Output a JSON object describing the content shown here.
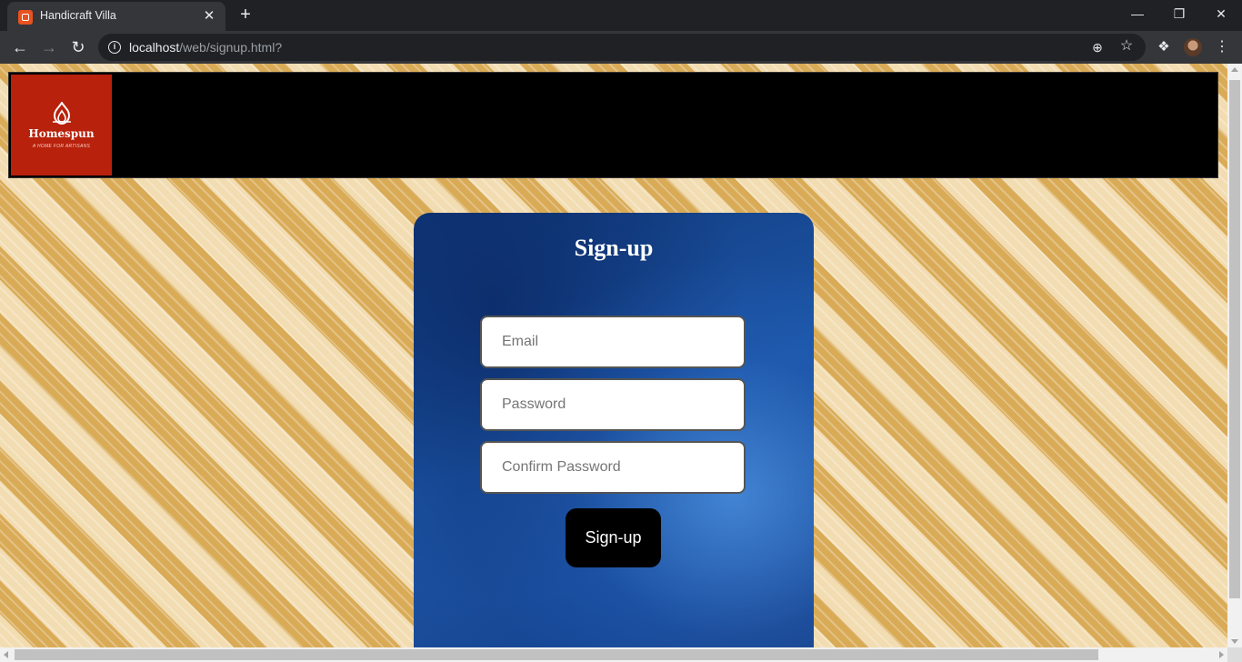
{
  "browser": {
    "tab_title": "Handicraft Villa",
    "tab_close": "✕",
    "new_tab": "+",
    "url_host": "localhost",
    "url_path": "/web/signup.html?"
  },
  "header": {
    "logo_name": "Homespun",
    "logo_tagline": "A HOME FOR ARTISANS",
    "logo_color": "#b8210b"
  },
  "signup": {
    "title": "Sign-up",
    "email_placeholder": "Email",
    "password_placeholder": "Password",
    "confirm_placeholder": "Confirm Password",
    "button_label": "Sign-up",
    "card_color": "#1c56a8"
  },
  "icons": {
    "favicon": "xampp-icon",
    "back": "arrow-left-icon",
    "forward": "arrow-right-icon",
    "reload": "reload-icon",
    "info": "info-icon",
    "zoom": "zoom-icon",
    "star": "star-icon",
    "extensions": "puzzle-icon",
    "menu": "kebab-menu-icon"
  }
}
